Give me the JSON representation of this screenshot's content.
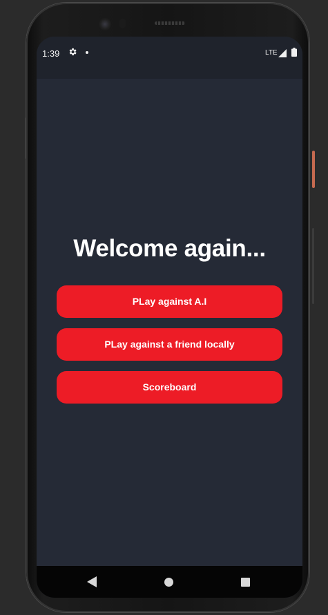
{
  "status_bar": {
    "time": "1:39",
    "network": "LTE",
    "icons": [
      "gear-icon",
      "notification-dot",
      "signal-icon",
      "battery-icon"
    ]
  },
  "main": {
    "title": "Welcome again...",
    "buttons": [
      {
        "label": "PLay against A.I"
      },
      {
        "label": "PLay against a friend locally"
      },
      {
        "label": "Scoreboard"
      }
    ]
  },
  "nav_bar": {
    "icons": [
      "back-icon",
      "home-icon",
      "recents-icon"
    ]
  },
  "colors": {
    "background": "#252a36",
    "status_bar": "#1f232c",
    "button": "#ed1c26",
    "title_text": "#ffffff",
    "nav_bar": "#050505"
  }
}
